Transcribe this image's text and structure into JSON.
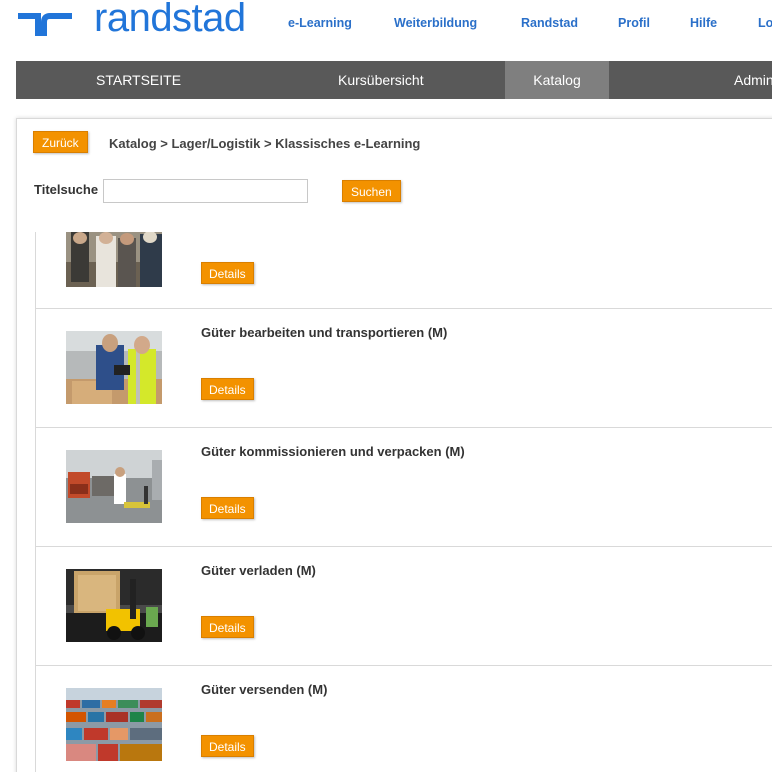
{
  "brand": {
    "name": "randstad",
    "color": "#2175d9"
  },
  "top_links": [
    "e-Learning",
    "Weiterbildung",
    "Randstad",
    "Profil",
    "Hilfe",
    "Lo"
  ],
  "main_nav": {
    "items": [
      "STARTSEITE",
      "Kursübersicht",
      "Katalog",
      "Administ"
    ],
    "active": "Katalog"
  },
  "content": {
    "back_label": "Zurück",
    "breadcrumb": "Katalog > Lager/Logistik > Klassisches e-Learning",
    "search": {
      "label": "Titelsuche",
      "value": "",
      "button_label": "Suchen"
    },
    "courses": [
      {
        "title": "",
        "details_label": "Details",
        "image": "workers-meeting-photo"
      },
      {
        "title": "Güter bearbeiten und transportieren (M)",
        "details_label": "Details",
        "image": "warehouse-workers-tablet-photo"
      },
      {
        "title": "Güter kommissionieren und verpacken (M)",
        "details_label": "Details",
        "image": "pallet-jack-warehouse-photo"
      },
      {
        "title": "Güter verladen (M)",
        "details_label": "Details",
        "image": "forklift-loading-photo"
      },
      {
        "title": "Güter versenden (M)",
        "details_label": "Details",
        "image": "shipping-containers-photo"
      }
    ]
  },
  "colors": {
    "accent": "#f39200",
    "link": "#2b70c9",
    "nav_bg": "#595959",
    "nav_active": "#7f7f7f"
  }
}
